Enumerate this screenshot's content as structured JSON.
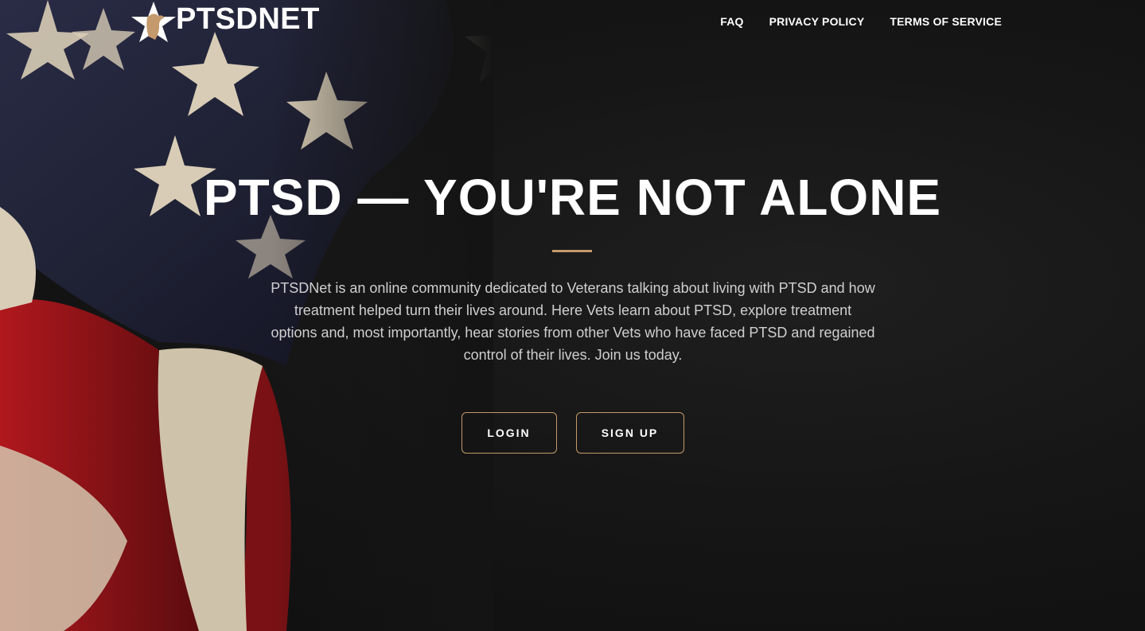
{
  "nav": {
    "brand_name": "PTSDNET",
    "brand_logo_icon": "star-eagle-logo-icon",
    "links": [
      {
        "label": "FAQ"
      },
      {
        "label": "PRIVACY POLICY"
      },
      {
        "label": "TERMS OF SERVICE"
      }
    ]
  },
  "hero": {
    "headline": "PTSD — YOU'RE NOT ALONE",
    "description": "PTSDNet is an online community dedicated to Veterans talking about living with PTSD and how treatment helped turn their lives around. Here Vets learn about PTSD, explore treatment options and, most importantly, hear stories from other Vets who have faced PTSD and regained control of their lives. Join us today.",
    "login_label": "LOGIN",
    "signup_label": "SIGN UP"
  },
  "colors": {
    "accent": "#c49a6c",
    "background": "#141414",
    "text_primary": "#ffffff",
    "text_secondary": "#cfcfcf",
    "flag_blue": "#1e2033",
    "flag_red": "#9b1519",
    "flag_white": "#d9cdb8"
  }
}
